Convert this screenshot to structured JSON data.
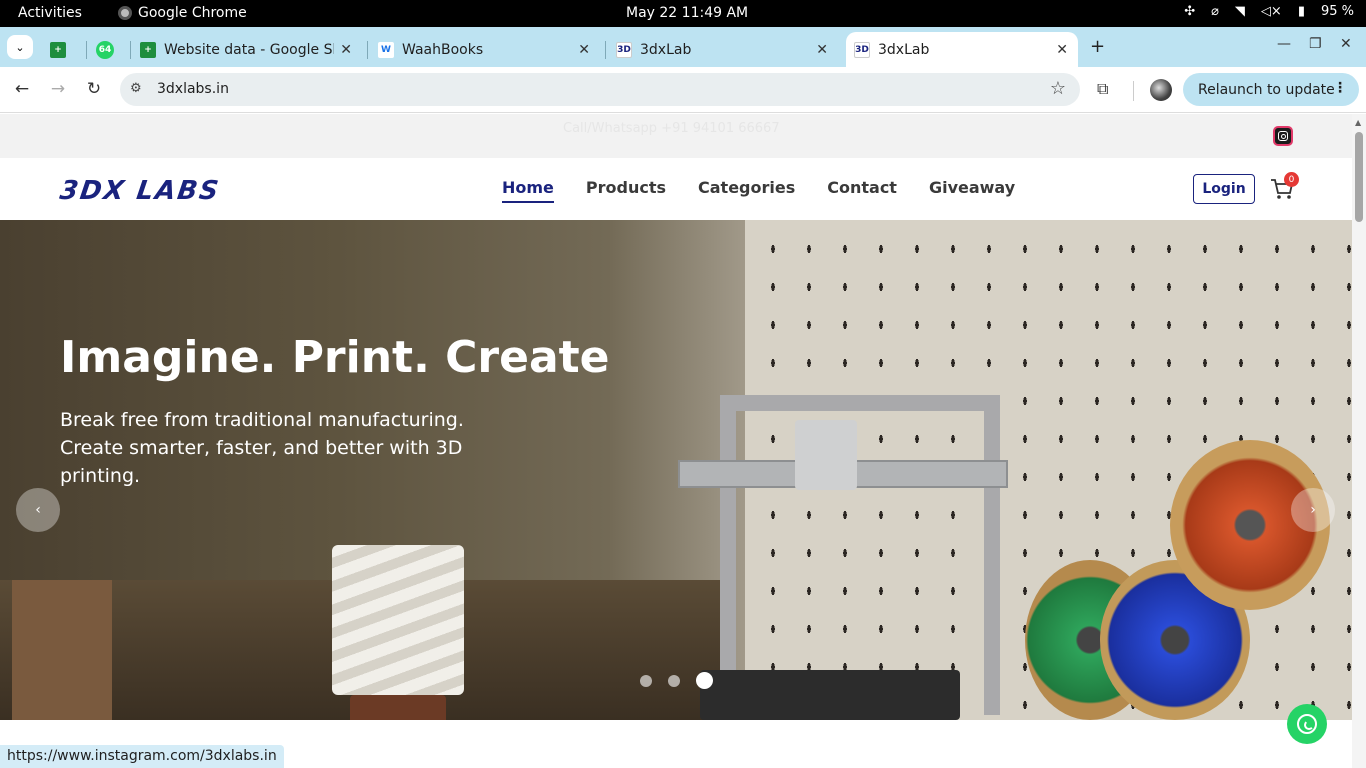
{
  "os": {
    "activities": "Activities",
    "app_name": "Google Chrome",
    "clock": "May 22  11:49 AM",
    "battery": "95 %"
  },
  "tabs": [
    {
      "title": "",
      "favicon": "sheets-icon",
      "color": "#1e8e3e"
    },
    {
      "title": "",
      "favicon": "whatsapp-icon",
      "badge": "64",
      "color": "#25d366"
    },
    {
      "title": "Website data - Google Sh",
      "favicon": "sheets-icon",
      "color": "#1e8e3e"
    },
    {
      "title": "WaahBooks",
      "favicon": "waahbooks-icon"
    },
    {
      "title": "3dxLab",
      "favicon": "3dx-icon"
    },
    {
      "title": "3dxLab",
      "favicon": "3dx-icon",
      "active": true
    }
  ],
  "toolbar": {
    "url": "3dxlabs.in",
    "relaunch_label": "Relaunch to update"
  },
  "page": {
    "call_text": "Call/Whatsapp +91 94101 66667",
    "logo_text": "3DX LABS",
    "nav": [
      "Home",
      "Products",
      "Categories",
      "Contact",
      "Giveaway"
    ],
    "login_label": "Login",
    "cart_count": "0",
    "hero_title": "Imagine. Print. Create",
    "hero_text": "Break free from traditional manufacturing. Create smarter, faster, and better with 3D printing.",
    "prev_label": "‹",
    "next_label": "›",
    "carousel_active_index": 2,
    "carousel_count": 3
  },
  "status_url": "https://www.instagram.com/3dxlabs.in",
  "colors": {
    "brand": "#1a237e",
    "tabstrip": "#bde3f2",
    "whatsapp": "#25d366",
    "badge": "#e53935"
  }
}
